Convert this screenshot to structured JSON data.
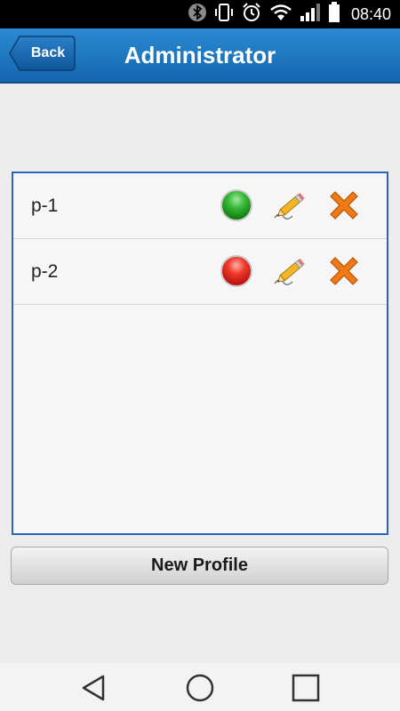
{
  "status_bar": {
    "time": "08:40",
    "icons": [
      "bluetooth-icon",
      "vibrate-icon",
      "alarm-icon",
      "wifi-icon",
      "signal-icon",
      "battery-icon"
    ]
  },
  "header": {
    "back_label": "Back",
    "title": "Administrator",
    "color": "#1a74bd"
  },
  "profiles": [
    {
      "name": "p-1",
      "status": "active",
      "status_color": "#2ea32e"
    },
    {
      "name": "p-2",
      "status": "inactive",
      "status_color": "#e0281c"
    }
  ],
  "actions": {
    "edit_icon": "pencil-icon",
    "delete_icon": "close-x-icon",
    "new_profile_label": "New Profile"
  },
  "nav_bar": {
    "icons": [
      "back-triangle-icon",
      "home-circle-icon",
      "recents-square-icon"
    ]
  }
}
